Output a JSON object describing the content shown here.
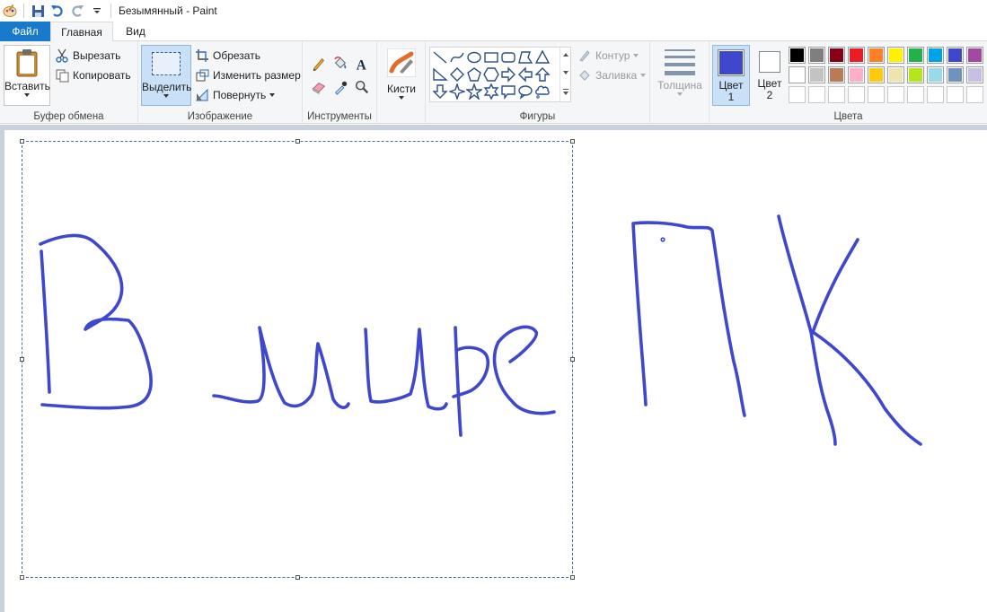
{
  "titlebar": {
    "title": "Безымянный - Paint"
  },
  "tabs": {
    "file": "Файл",
    "home": "Главная",
    "view": "Вид"
  },
  "clipboard": {
    "paste": "Вставить",
    "cut": "Вырезать",
    "copy": "Копировать",
    "label": "Буфер обмена"
  },
  "image": {
    "select": "Выделить",
    "crop": "Обрезать",
    "resize": "Изменить размер",
    "rotate": "Повернуть",
    "label": "Изображение"
  },
  "tools": {
    "label": "Инструменты",
    "items": [
      "pencil-icon",
      "fill-icon",
      "text-icon",
      "eraser-icon",
      "color-picker-icon",
      "magnifier-icon"
    ]
  },
  "brushes": {
    "label": "Кисти"
  },
  "shapes": {
    "label": "Фигуры",
    "outline": "Контур",
    "fill": "Заливка"
  },
  "thickness": {
    "label": "Толщина"
  },
  "color1": {
    "line1": "Цвет",
    "line2": "1",
    "value": "#3f48cc"
  },
  "color2": {
    "line1": "Цвет",
    "line2": "2",
    "value": "#ffffff"
  },
  "colors": {
    "label": "Цвета",
    "row1": [
      "#000000",
      "#7f7f7f",
      "#880015",
      "#ed1c24",
      "#ff7f27",
      "#fff200",
      "#22b14c",
      "#00a2e8",
      "#3f48cc",
      "#a349a4"
    ],
    "row2": [
      "#ffffff",
      "#c3c3c3",
      "#b97a57",
      "#ffaec9",
      "#ffc90e",
      "#efe4b0",
      "#b5e61d",
      "#99d9ea",
      "#7092be",
      "#c8bfe7"
    ],
    "row3": [
      "#ffffff",
      "#ffffff",
      "#ffffff",
      "#ffffff",
      "#ffffff",
      "#ffffff",
      "#ffffff",
      "#ffffff",
      "#ffffff",
      "#ffffff"
    ]
  },
  "accent": "#1979ca",
  "drawing": {
    "stroke_color": "#3f48cc"
  }
}
